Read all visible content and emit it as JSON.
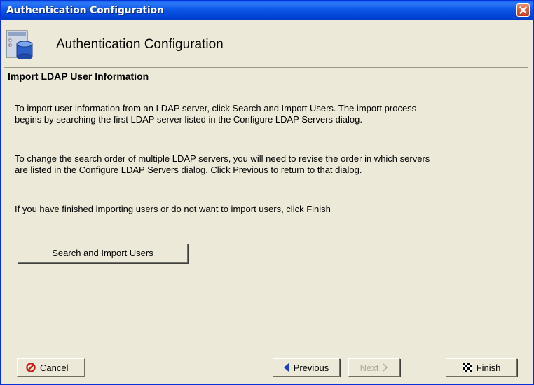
{
  "window": {
    "title": "Authentication Configuration"
  },
  "header": {
    "title": "Authentication Configuration",
    "icon": "server-database-icon"
  },
  "section": {
    "title": "Import LDAP User Information"
  },
  "content": {
    "paragraph1": "To import user information from an LDAP server, click Search and Import Users. The import process begins by searching the first LDAP server listed in the Configure LDAP Servers dialog.",
    "paragraph2": "To change the search order of multiple LDAP servers, you will need to revise the order in which servers are listed in the Configure LDAP Servers dialog.  Click Previous to return to that dialog.",
    "paragraph3": "If you have finished importing users or do not want to import users, click Finish",
    "search_button": "Search and Import Users"
  },
  "footer": {
    "cancel": {
      "mnemonic": "C",
      "rest": "ancel",
      "icon": "cancel-icon"
    },
    "previous": {
      "mnemonic": "P",
      "rest": "revious",
      "icon": "left-arrow-icon"
    },
    "next": {
      "mnemonic": "N",
      "rest": "ext",
      "icon": "right-chevron-icon",
      "enabled": false
    },
    "finish": {
      "label": "Finish",
      "icon": "checkered-flag-icon"
    }
  },
  "colors": {
    "title_bar": "#0055e5",
    "dialog_bg": "#ece9d8",
    "close_button": "#d9583a",
    "disabled_text": "#aca899"
  }
}
